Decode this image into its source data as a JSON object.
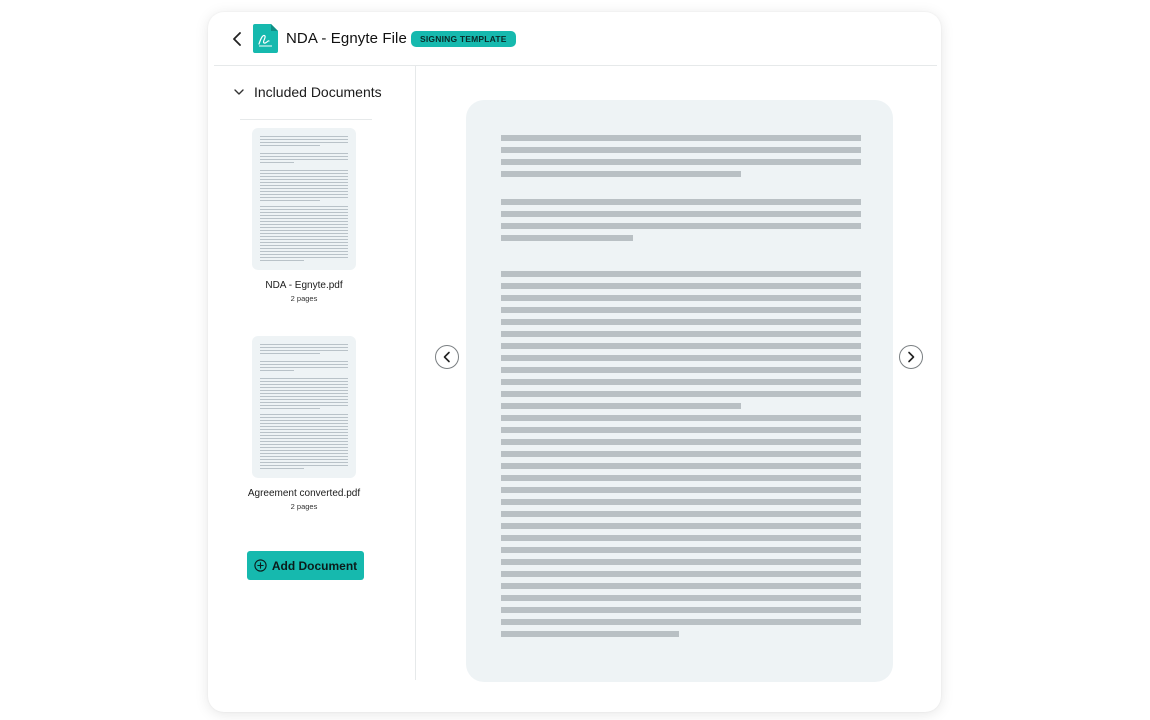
{
  "header": {
    "title": "NDA - Egnyte File",
    "badge": "SIGNING TEMPLATE"
  },
  "sidebar": {
    "section_label": "Included Documents",
    "documents": [
      {
        "name": "NDA - Egnyte.pdf",
        "pages": "2 pages"
      },
      {
        "name": "Agreement converted.pdf",
        "pages": "2 pages"
      }
    ],
    "add_button_label": "Add Document"
  },
  "colors": {
    "accent": "#16b9ae",
    "preview_bg": "#eef3f5",
    "text_line": "#b9c0c4"
  },
  "icons": {
    "back": "chevron-left-icon",
    "file": "signature-file-icon",
    "section": "chevron-down-icon",
    "add": "plus-circle-icon",
    "prev": "chevron-left-icon",
    "next": "chevron-right-icon"
  }
}
